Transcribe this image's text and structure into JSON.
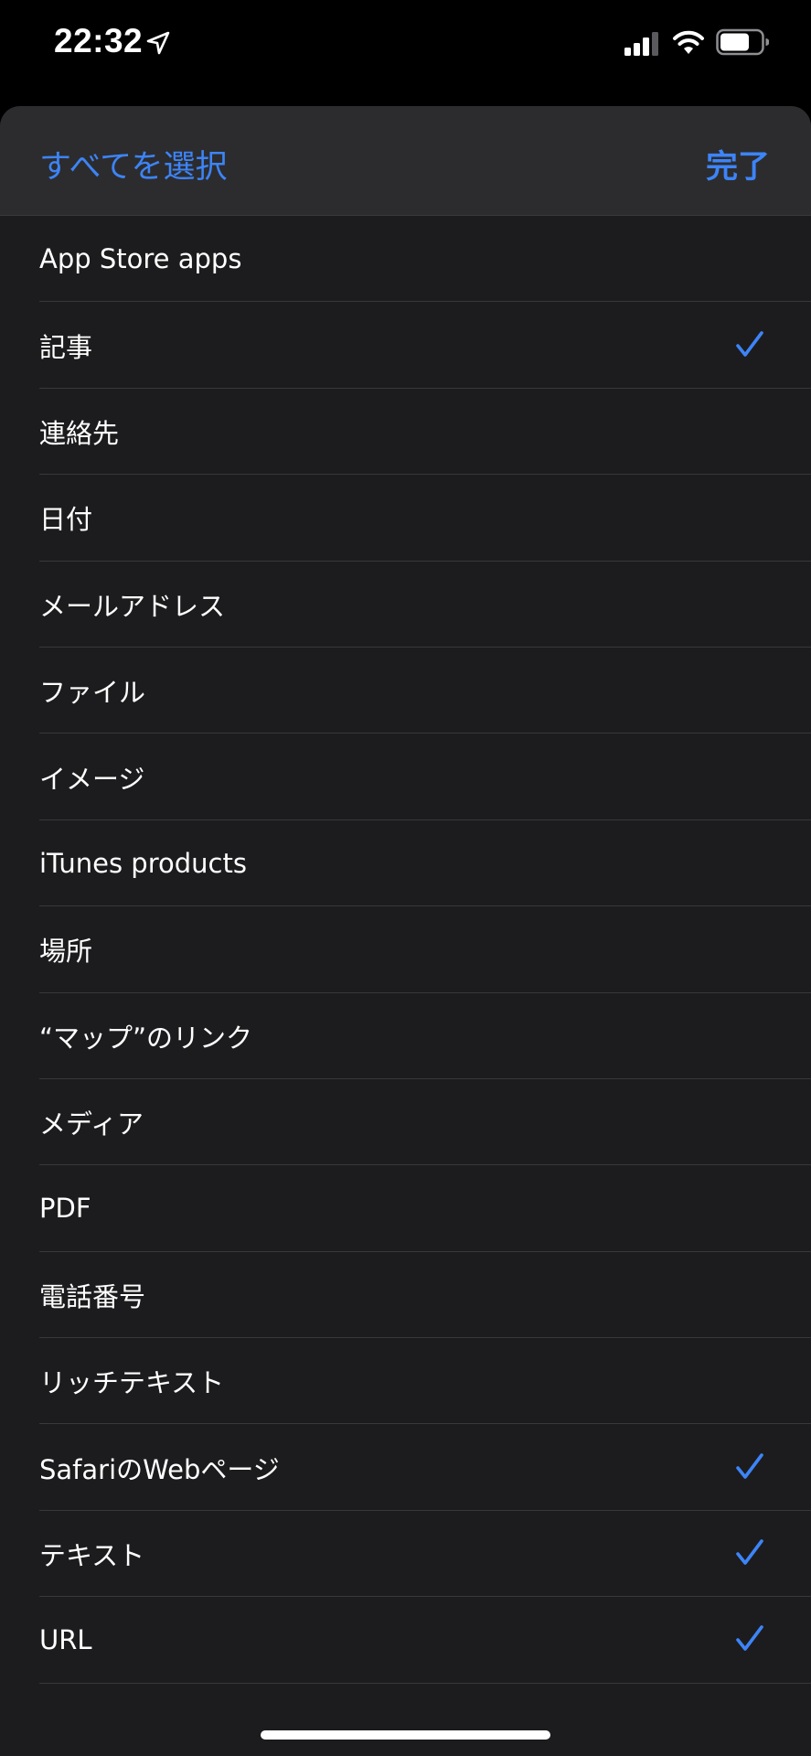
{
  "status_bar": {
    "time": "22:32"
  },
  "header": {
    "select_all_label": "すべてを選択",
    "done_label": "完了"
  },
  "accent_color": "#3d84f7",
  "items": [
    {
      "label": "App Store apps",
      "checked": false
    },
    {
      "label": "記事",
      "checked": true
    },
    {
      "label": "連絡先",
      "checked": false
    },
    {
      "label": "日付",
      "checked": false
    },
    {
      "label": "メールアドレス",
      "checked": false
    },
    {
      "label": "ファイル",
      "checked": false
    },
    {
      "label": "イメージ",
      "checked": false
    },
    {
      "label": "iTunes products",
      "checked": false
    },
    {
      "label": "場所",
      "checked": false
    },
    {
      "label": "“マップ”のリンク",
      "checked": false
    },
    {
      "label": "メディア",
      "checked": false
    },
    {
      "label": "PDF",
      "checked": false
    },
    {
      "label": "電話番号",
      "checked": false
    },
    {
      "label": "リッチテキスト",
      "checked": false
    },
    {
      "label": "SafariのWebページ",
      "checked": true
    },
    {
      "label": "テキスト",
      "checked": true
    },
    {
      "label": "URL",
      "checked": true
    }
  ],
  "icons": {
    "location": "location-arrow-icon",
    "signal": "cellular-signal-icon",
    "wifi": "wifi-icon",
    "battery": "battery-icon",
    "check": "checkmark-icon"
  }
}
